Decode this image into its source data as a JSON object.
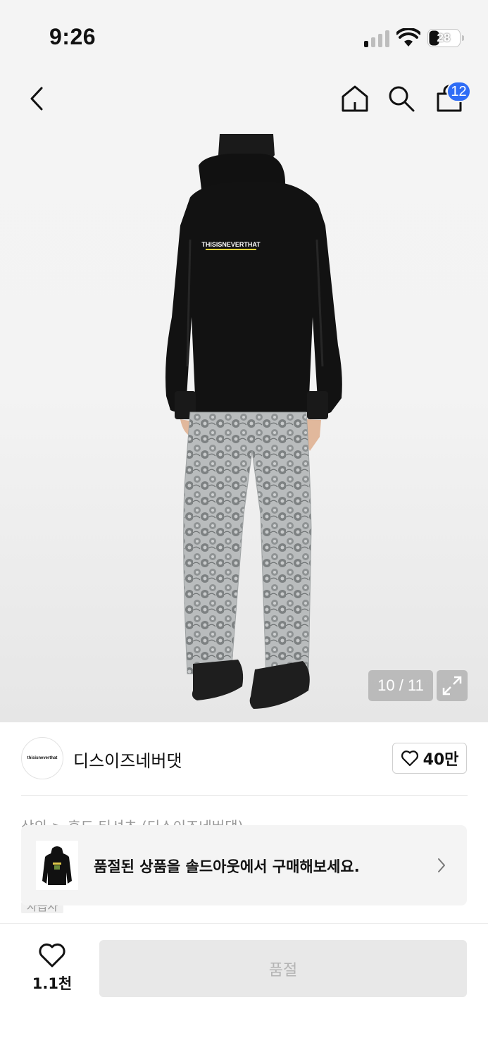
{
  "status_bar": {
    "time": "9:26",
    "battery": "28"
  },
  "nav": {
    "cart_count": "12",
    "icons": [
      "back-icon",
      "home-icon",
      "search-icon",
      "shopping-bag-icon"
    ]
  },
  "gallery": {
    "counter": "10 / 11",
    "current_index": 10,
    "total": 11,
    "print_text": "THISISNEVERTHAT"
  },
  "brand": {
    "logo_text": "thisisneverthat",
    "name": "디스이즈네버댓",
    "likes": "40만"
  },
  "breadcrumb_peek": "상의 > 후드 티셔츠 (디스이즈네버댓)",
  "tag_peek": "자급자",
  "soldout_banner": {
    "text": "품절된 상품을 솔드아웃에서 구매해보세요."
  },
  "bottom_bar": {
    "wish_count": "1.1천",
    "buy_label": "품절"
  },
  "colors": {
    "badge": "#2f6df6",
    "disabled_button": "#e8e8e8",
    "disabled_text": "#b4b4b4"
  }
}
